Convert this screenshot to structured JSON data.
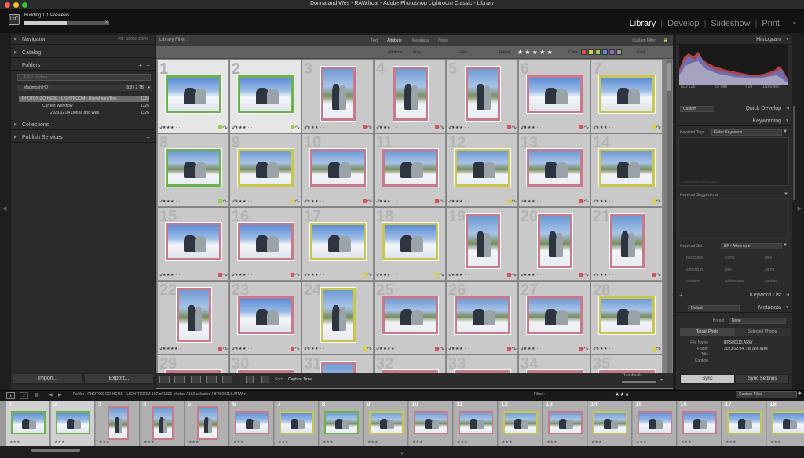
{
  "window": {
    "title": "Donna and Wes - RAW.lrcat - Adobe Photoshop Lightroom Classic - Library"
  },
  "app": {
    "logo": "LrC",
    "status": "Building 1:1 Previews",
    "progress": 0.5,
    "progress_close": "✕"
  },
  "modules": {
    "items": [
      "Library",
      "Develop",
      "Slideshow",
      "Print"
    ],
    "separator": "|",
    "active": "Library"
  },
  "left_panel": {
    "navigator": {
      "title": "Navigator",
      "zoom": [
        "FIT",
        "100%",
        "200%"
      ]
    },
    "catalog": {
      "title": "Catalog"
    },
    "folders": {
      "title": "Folders",
      "plus": "+",
      "minus": "−"
    },
    "folder_search": {
      "placeholder": "Filter Folders"
    },
    "drive": {
      "name": "Macintosh HD",
      "size": "8.8 / 2 TB"
    },
    "tree": [
      {
        "label": "PHOTOS GO HERE - LIGHTROOM - Users/marc/Des...",
        "count": "1326"
      },
      {
        "label": "Current Workflow",
        "count": "1326"
      },
      {
        "label": "2023.02.04 Donna and Wes",
        "count": "1326"
      }
    ],
    "collections": {
      "title": "Collections"
    },
    "publish": {
      "title": "Publish Services"
    },
    "import_label": "Import...",
    "export_label": "Export..."
  },
  "library_filter": {
    "title": "Library Filter :",
    "tabs": [
      "Text",
      "Attribute",
      "Metadata",
      "None"
    ],
    "active_tab": "Attribute",
    "custom": "Custom Filter",
    "attr": {
      "label": "Attribute",
      "flag": "Flag",
      "edits": "Edits",
      "rating": "Rating",
      "color": "Color",
      "kind": "Kind",
      "stars": "★ ★ ★ ★ ★"
    }
  },
  "grid": {
    "cells": [
      {
        "num": "1",
        "stars": "★★★ · ·",
        "label": "#9ad04d",
        "frame": "#6db24a",
        "style": "snow",
        "sel": true,
        "orient": "h"
      },
      {
        "num": "2",
        "stars": "★★★ · ·",
        "label": "#9ad04d",
        "frame": "#6db24a",
        "style": "snow",
        "sel": true,
        "orient": "h"
      },
      {
        "num": "3",
        "stars": "★★★ · ·",
        "label": "#d45555",
        "frame": "#c77b8a",
        "style": "sky",
        "sel": false,
        "orient": "v"
      },
      {
        "num": "4",
        "stars": "★★★ · ·",
        "label": "#d45555",
        "frame": "#c77b8a",
        "style": "sky",
        "sel": false,
        "orient": "v"
      },
      {
        "num": "5",
        "stars": "★★★ · ·",
        "label": "#d45555",
        "frame": "#c77b8a",
        "style": "sky",
        "sel": false,
        "orient": "v"
      },
      {
        "num": "6",
        "stars": "★★★ · ·",
        "label": "#d45555",
        "frame": "#c77b8a",
        "style": "snow",
        "sel": false,
        "orient": "h"
      },
      {
        "num": "7",
        "stars": "★★★ · ·",
        "label": "#e0d040",
        "frame": "#c9c64f",
        "style": "snow",
        "sel": false,
        "orient": "h"
      },
      {
        "num": "8",
        "stars": "★★★ · ·",
        "label": "#9ad04d",
        "frame": "#6db24a",
        "style": "sky",
        "sel": false,
        "orient": "h"
      },
      {
        "num": "9",
        "stars": "★★★ · ·",
        "label": "#e0d040",
        "frame": "#c9c64f",
        "style": "sky",
        "sel": false,
        "orient": "h"
      },
      {
        "num": "10",
        "stars": "★★★ · ·",
        "label": "#d45555",
        "frame": "#c77b8a",
        "style": "sky",
        "sel": false,
        "orient": "h"
      },
      {
        "num": "11",
        "stars": "★★★ · ·",
        "label": "#d45555",
        "frame": "#c77b8a",
        "style": "sky",
        "sel": false,
        "orient": "h"
      },
      {
        "num": "12",
        "stars": "★★★ · ·",
        "label": "#e0d040",
        "frame": "#c9c64f",
        "style": "sky",
        "sel": false,
        "orient": "h"
      },
      {
        "num": "13",
        "stars": "★★★ · ·",
        "label": "#d45555",
        "frame": "#c77b8a",
        "style": "sky",
        "sel": false,
        "orient": "h"
      },
      {
        "num": "14",
        "stars": "★★★ · ·",
        "label": "#e0d040",
        "frame": "#c9c64f",
        "style": "sky",
        "sel": false,
        "orient": "h"
      },
      {
        "num": "15",
        "stars": "★★★ · ·",
        "label": "#d45555",
        "frame": "#c77b8a",
        "style": "snow",
        "sel": false,
        "orient": "h"
      },
      {
        "num": "16",
        "stars": "★★★ · ·",
        "label": "#d45555",
        "frame": "#c77b8a",
        "style": "snow",
        "sel": false,
        "orient": "h"
      },
      {
        "num": "17",
        "stars": "★★★ · ·",
        "label": "#e0d040",
        "frame": "#c9c64f",
        "style": "snow",
        "sel": false,
        "orient": "h"
      },
      {
        "num": "18",
        "stars": "★★★ · ·",
        "label": "#e0d040",
        "frame": "#c9c64f",
        "style": "snow",
        "sel": false,
        "orient": "h"
      },
      {
        "num": "19",
        "stars": "★★★ · ·",
        "label": "#d45555",
        "frame": "#c77b8a",
        "style": "sky",
        "sel": false,
        "orient": "v"
      },
      {
        "num": "20",
        "stars": "★★★ · ·",
        "label": "#d45555",
        "frame": "#c77b8a",
        "style": "sky",
        "sel": false,
        "orient": "v"
      },
      {
        "num": "21",
        "stars": "★★★ · ·",
        "label": "#d45555",
        "frame": "#c77b8a",
        "style": "sky",
        "sel": false,
        "orient": "v"
      },
      {
        "num": "22",
        "stars": "★★★★ ·",
        "label": "#d45555",
        "frame": "#c77b8a",
        "style": "sky",
        "sel": false,
        "orient": "v"
      },
      {
        "num": "23",
        "stars": "★★★ · ·",
        "label": "#d45555",
        "frame": "#c77b8a",
        "style": "snow",
        "sel": false,
        "orient": "h"
      },
      {
        "num": "24",
        "stars": "★★★ · ·",
        "label": "#e0d040",
        "frame": "#c9c64f",
        "style": "sky",
        "sel": false,
        "orient": "v"
      },
      {
        "num": "25",
        "stars": "★★★★ ·",
        "label": "#d45555",
        "frame": "#c77b8a",
        "style": "sky",
        "sel": false,
        "orient": "h"
      },
      {
        "num": "26",
        "stars": "★★★ · ·",
        "label": "#d45555",
        "frame": "#c77b8a",
        "style": "sky",
        "sel": false,
        "orient": "h"
      },
      {
        "num": "27",
        "stars": "★★★ · ·",
        "label": "#d45555",
        "frame": "#c77b8a",
        "style": "sky",
        "sel": false,
        "orient": "h"
      },
      {
        "num": "28",
        "stars": "★★★ · ·",
        "label": "#e0d040",
        "frame": "#c9c64f",
        "style": "sky",
        "sel": false,
        "orient": "h"
      },
      {
        "num": "29",
        "stars": "",
        "label": "",
        "frame": "#c77b8a",
        "style": "sky",
        "sel": false,
        "orient": "h"
      },
      {
        "num": "30",
        "stars": "",
        "label": "",
        "frame": "#c77b8a",
        "style": "sky",
        "sel": false,
        "orient": "h"
      },
      {
        "num": "31",
        "stars": "",
        "label": "",
        "frame": "#c77b8a",
        "style": "sky",
        "sel": false,
        "orient": "v"
      },
      {
        "num": "32",
        "stars": "",
        "label": "",
        "frame": "#c77b8a",
        "style": "sky",
        "sel": false,
        "orient": "h"
      },
      {
        "num": "33",
        "stars": "",
        "label": "",
        "frame": "#c77b8a",
        "style": "sky",
        "sel": false,
        "orient": "h"
      },
      {
        "num": "34",
        "stars": "",
        "label": "",
        "frame": "#c77b8a",
        "style": "sky",
        "sel": false,
        "orient": "h"
      },
      {
        "num": "35",
        "stars": "",
        "label": "",
        "frame": "#c77b8a",
        "style": "sky",
        "sel": false,
        "orient": "h"
      }
    ]
  },
  "toolbar": {
    "sort_label": "Sort:",
    "sort_value": "Capture Time",
    "thumbnails_label": "Thumbnails"
  },
  "right_panel": {
    "histogram": {
      "title": "Histogram",
      "info": [
        "ISO 125",
        "57 mm",
        "f / 10",
        "1/100 sec"
      ]
    },
    "quick_develop": {
      "title": "Quick Develop",
      "preset": "Custom"
    },
    "keywording": {
      "title": "Keywording",
      "tags_label": "Keyword Tags",
      "tags_value": "Enter Keywords",
      "hint": "Click here to add keywords",
      "suggestions": "Keyword Suggestions",
      "set_label": "Keyword Set",
      "set_value": "BP - Adventure",
      "set_tags": [
        "backpack",
        "climb",
        "hike",
        "adventure",
        "sky",
        "camp",
        "outdoor",
        "wilderness",
        "explore"
      ]
    },
    "keyword_list": {
      "title": "Keyword List"
    },
    "metadata": {
      "title": "Metadata",
      "preset_select": "Default",
      "preset_label": "Preset",
      "preset_value": "None",
      "tab_target": "Target Photo",
      "tab_selected": "Selected Photos",
      "fields": [
        {
          "label": "File Name",
          "value": "BPS00113.ARW"
        },
        {
          "label": "Folder",
          "value": "2023.02.04...na and Wes"
        },
        {
          "label": "Title",
          "value": ""
        },
        {
          "label": "Caption",
          "value": ""
        }
      ]
    },
    "sync_label": "Sync",
    "sync_settings_label": "Sync Settings"
  },
  "filmbar": {
    "path": "Folder : PHOTOS GO HERE - LIGHTROOM     192 of 1326 photos / 192 selected / BPS00113.ARW ▾",
    "filter_label": "Filter :",
    "stars": "★★★",
    "custom": "Custom Filter",
    "page_buttons": [
      "1",
      "2"
    ]
  },
  "filmstrip": {
    "cells": [
      {
        "num": "1",
        "frame": "#6db24a",
        "style": "snow",
        "sel": true,
        "orient": "h",
        "stars": "★★★"
      },
      {
        "num": "2",
        "frame": "#6db24a",
        "style": "snow",
        "sel": true,
        "orient": "h",
        "stars": "★★★"
      },
      {
        "num": "3",
        "frame": "#c77b8a",
        "style": "sky",
        "sel": false,
        "orient": "v",
        "stars": "★★★"
      },
      {
        "num": "4",
        "frame": "#c77b8a",
        "style": "sky",
        "sel": false,
        "orient": "v",
        "stars": "★★★"
      },
      {
        "num": "5",
        "frame": "#c77b8a",
        "style": "sky",
        "sel": false,
        "orient": "v",
        "stars": "★★★"
      },
      {
        "num": "6",
        "frame": "#c77b8a",
        "style": "snow",
        "sel": false,
        "orient": "h",
        "stars": "★★★"
      },
      {
        "num": "7",
        "frame": "#c9c64f",
        "style": "snow",
        "sel": false,
        "orient": "h",
        "stars": "★★★"
      },
      {
        "num": "8",
        "frame": "#6db24a",
        "style": "sky",
        "sel": false,
        "orient": "h",
        "stars": "★★★"
      },
      {
        "num": "9",
        "frame": "#c9c64f",
        "style": "sky",
        "sel": false,
        "orient": "h",
        "stars": "★★★"
      },
      {
        "num": "10",
        "frame": "#c77b8a",
        "style": "sky",
        "sel": false,
        "orient": "h",
        "stars": "★★★"
      },
      {
        "num": "11",
        "frame": "#c77b8a",
        "style": "sky",
        "sel": false,
        "orient": "h",
        "stars": "★★★"
      },
      {
        "num": "12",
        "frame": "#c9c64f",
        "style": "sky",
        "sel": false,
        "orient": "h",
        "stars": "★★★"
      },
      {
        "num": "13",
        "frame": "#c77b8a",
        "style": "sky",
        "sel": false,
        "orient": "h",
        "stars": "★★★"
      },
      {
        "num": "14",
        "frame": "#c9c64f",
        "style": "sky",
        "sel": false,
        "orient": "h",
        "stars": "★★★"
      },
      {
        "num": "15",
        "frame": "#c77b8a",
        "style": "snow",
        "sel": false,
        "orient": "h",
        "stars": "★★★"
      },
      {
        "num": "16",
        "frame": "#c77b8a",
        "style": "snow",
        "sel": false,
        "orient": "h",
        "stars": "★★★"
      },
      {
        "num": "17",
        "frame": "#c9c64f",
        "style": "snow",
        "sel": false,
        "orient": "h",
        "stars": "★★★"
      },
      {
        "num": "18",
        "frame": "#c9c64f",
        "style": "snow",
        "sel": false,
        "orient": "h",
        "stars": "★★★"
      }
    ]
  }
}
